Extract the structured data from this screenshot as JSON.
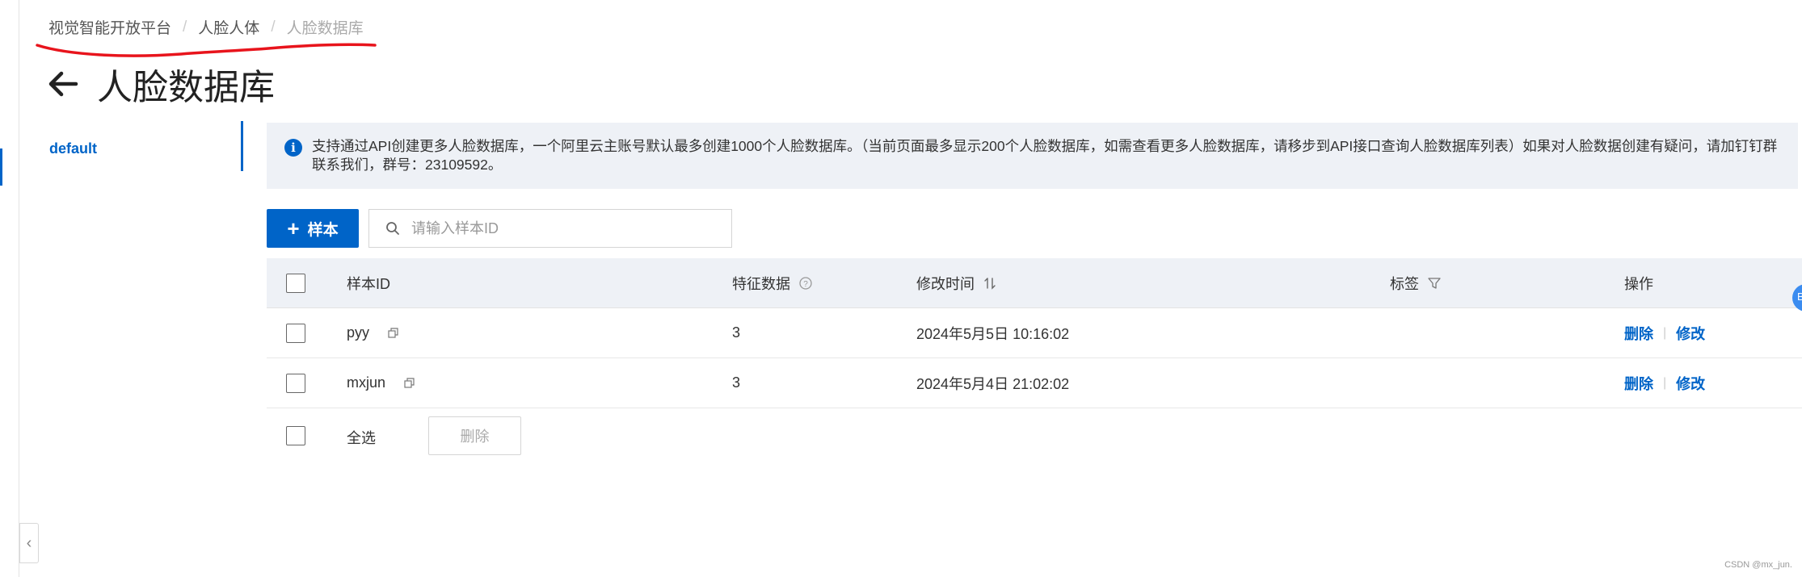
{
  "breadcrumb": {
    "items": [
      "视觉智能开放平台",
      "人脸人体",
      "人脸数据库"
    ],
    "separator": "/"
  },
  "page": {
    "title": "人脸数据库",
    "back_icon": "arrow-left-icon"
  },
  "side_nav": {
    "items": [
      {
        "label": "default",
        "active": true
      }
    ]
  },
  "notice": {
    "icon": "info-icon",
    "icon_glyph": "i",
    "text": "支持通过API创建更多人脸数据库，一个阿里云主账号默认最多创建1000个人脸数据库。（当前页面最多显示200个人脸数据库，如需查看更多人脸数据库，请移步到API接口查询人脸数据库列表）如果对人脸数据创建有疑问，请加钉钉群联系我们，群号：23109592。"
  },
  "toolbar": {
    "add_button_plus": "+",
    "add_button_label": "样本",
    "search_placeholder": "请输入样本ID"
  },
  "table": {
    "headers": {
      "sample_id": "样本ID",
      "features": "特征数据",
      "modified": "修改时间",
      "tags": "标签",
      "actions": "操作"
    },
    "rows": [
      {
        "id": "pyy",
        "features": "3",
        "modified": "2024年5月5日 10:16:02",
        "tags": "",
        "delete": "删除",
        "edit": "修改"
      },
      {
        "id": "mxjun",
        "features": "3",
        "modified": "2024年5月4日 21:02:02",
        "tags": "",
        "delete": "删除",
        "edit": "修改"
      }
    ],
    "action_separator": "|"
  },
  "footer": {
    "select_all": "全选",
    "bulk_delete": "删除"
  },
  "float_button": {
    "label": "B"
  },
  "watermark": "CSDN @mx_jun.",
  "colors": {
    "accent": "#0064c8",
    "notice_bg": "#eef1f6",
    "annotation_red": "#e8141c"
  }
}
